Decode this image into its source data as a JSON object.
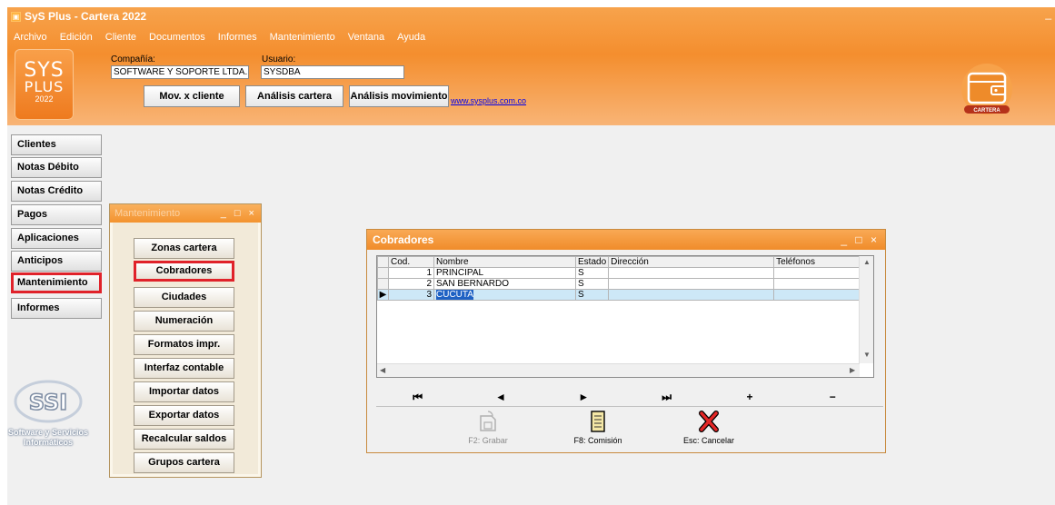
{
  "window": {
    "title": "SyS Plus - Cartera 2022"
  },
  "menu": [
    "Archivo",
    "Edición",
    "Cliente",
    "Documentos",
    "Informes",
    "Mantenimiento",
    "Ventana",
    "Ayuda"
  ],
  "logo": {
    "line1": "SYS",
    "line2": "PLUS",
    "line3": "2022"
  },
  "header": {
    "company_label": "Compañía:",
    "company_value": "SOFTWARE Y SOPORTE LTDA.",
    "user_label": "Usuario:",
    "user_value": "SYSDBA",
    "buttons": [
      "Mov. x cliente",
      "Análisis cartera",
      "Análisis movimiento"
    ],
    "link": "www.sysplus.com.co",
    "wallet_badge": "CARTERA"
  },
  "sidebar": [
    {
      "label": "Clientes",
      "selected": false
    },
    {
      "label": "Notas Débito",
      "selected": false
    },
    {
      "label": "Notas Crédito",
      "selected": false
    },
    {
      "label": "Pagos",
      "selected": false
    },
    {
      "label": "Aplicaciones",
      "selected": false
    },
    {
      "label": "Anticipos",
      "selected": false
    },
    {
      "label": "Mantenimiento",
      "selected": true
    },
    {
      "label": "Informes",
      "selected": false
    }
  ],
  "ssi": {
    "logo_text": "SSI",
    "caption1": "Software y Servicios",
    "caption2": "Informáticos"
  },
  "mant_window": {
    "title": "Mantenimiento",
    "buttons": [
      {
        "label": "Zonas cartera",
        "selected": false
      },
      {
        "label": "Cobradores",
        "selected": true
      },
      {
        "label": "Ciudades",
        "selected": false
      },
      {
        "label": "Numeración",
        "selected": false
      },
      {
        "label": "Formatos impr.",
        "selected": false
      },
      {
        "label": "Interfaz contable",
        "selected": false
      },
      {
        "label": "Importar datos",
        "selected": false
      },
      {
        "label": "Exportar datos",
        "selected": false
      },
      {
        "label": "Recalcular saldos",
        "selected": false
      },
      {
        "label": "Grupos cartera",
        "selected": false
      }
    ]
  },
  "cob_window": {
    "title": "Cobradores",
    "columns": [
      "Cod.",
      "Nombre",
      "Estado",
      "Dirección",
      "Teléfonos"
    ],
    "rows": [
      {
        "cod": "1",
        "nombre": "PRINCIPAL",
        "estado": "S",
        "direccion": "",
        "telefonos": "",
        "current": false
      },
      {
        "cod": "2",
        "nombre": "SAN BERNARDO",
        "estado": "S",
        "direccion": "",
        "telefonos": "",
        "current": false
      },
      {
        "cod": "3",
        "nombre": "CUCUTA",
        "estado": "S",
        "direccion": "",
        "telefonos": "",
        "current": true
      }
    ],
    "nav": [
      "⏮",
      "◄",
      "►",
      "⏭",
      "+",
      "−"
    ],
    "actions": [
      "F2: Grabar",
      "F8: Comisión",
      "Esc: Cancelar"
    ]
  },
  "colors": {
    "header_orange": "#f48e2e",
    "highlight_red": "#e0222a",
    "selection_blue": "#1f62c4"
  }
}
